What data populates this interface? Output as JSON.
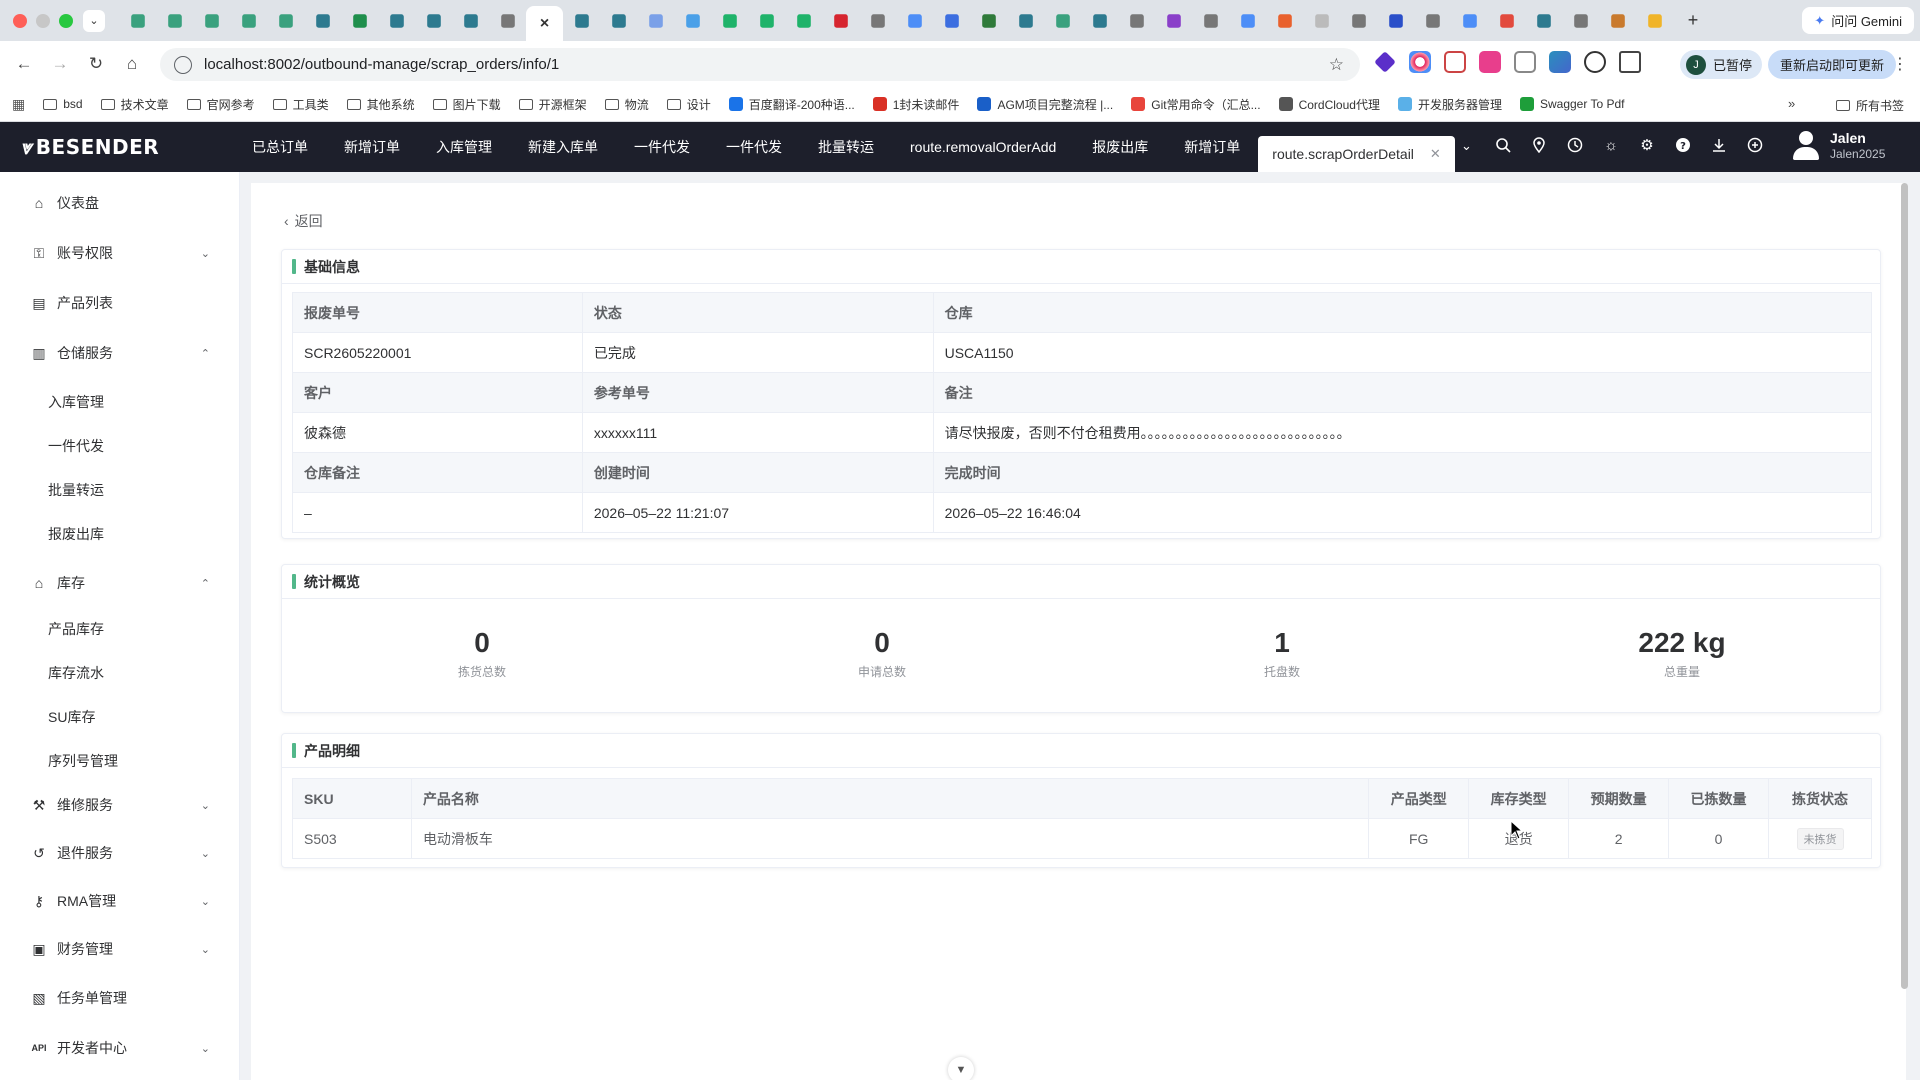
{
  "browser": {
    "url": "localhost:8002/outbound-manage/scrap_orders/info/1",
    "gemini_label": "问问 Gemini",
    "paused_label": "已暂停",
    "paused_avatar": "J",
    "relaunch_label": "重新启动即可更新",
    "bookmarks": [
      "bsd",
      "技术文章",
      "官网参考",
      "工具类",
      "其他系统",
      "图片下载",
      "开源框架",
      "物流",
      "设计",
      "百度翻译-200种语...",
      "1封未读邮件",
      "AGM项目完整流程 |...",
      "Git常用命令（汇总...",
      "CordCloud代理",
      "开发服务器管理",
      "Swagger To Pdf"
    ],
    "all_bookmarks": "所有书签"
  },
  "app": {
    "logo": "BESENDER",
    "nav_tabs": [
      "已总订单",
      "新增订单",
      "入库管理",
      "新建入库单",
      "一件代发",
      "一件代发",
      "批量转运",
      "route.removalOrderAdd",
      "报废出库",
      "新增订单",
      "route.scrapOrderDetail"
    ],
    "user_name": "Jalen",
    "user_sub": "Jalen2025"
  },
  "sidebar": {
    "items": [
      {
        "label": "仪表盘",
        "icon": "home-icon"
      },
      {
        "label": "账号权限",
        "icon": "key-icon"
      },
      {
        "label": "产品列表",
        "icon": "list-icon"
      },
      {
        "label": "仓储服务",
        "icon": "warehouse-icon"
      },
      {
        "label": "入库管理"
      },
      {
        "label": "一件代发"
      },
      {
        "label": "批量转运"
      },
      {
        "label": "报废出库"
      },
      {
        "label": "库存",
        "icon": "store-icon"
      },
      {
        "label": "产品库存"
      },
      {
        "label": "库存流水"
      },
      {
        "label": "SU库存"
      },
      {
        "label": "序列号管理"
      },
      {
        "label": "维修服务",
        "icon": "wrench-icon"
      },
      {
        "label": "退件服务",
        "icon": "return-icon"
      },
      {
        "label": "RMA管理",
        "icon": "lock-icon"
      },
      {
        "label": "财务管理",
        "icon": "finance-icon"
      },
      {
        "label": "任务单管理",
        "icon": "task-icon"
      },
      {
        "label": "开发者中心",
        "icon": "api-icon"
      }
    ],
    "api_badge": "API"
  },
  "page": {
    "back_label": "返回",
    "basic": {
      "title": "基础信息",
      "labels": [
        "报废单号",
        "状态",
        "仓库",
        "客户",
        "参考单号",
        "备注",
        "仓库备注",
        "创建时间",
        "完成时间"
      ],
      "values": [
        "SCR2605220001",
        "已完成",
        "USCA1150",
        "彼森德",
        "xxxxxx111",
        "请尽快报废，否则不付仓租费用。。。。。。。。。。。。。。。。。。。。。。。。。。。。。",
        "–",
        "2026–05–22 11:21:07",
        "2026–05–22 16:46:04"
      ]
    },
    "stats": {
      "title": "统计概览",
      "items": [
        {
          "value": "0",
          "label": "拣货总数"
        },
        {
          "value": "0",
          "label": "申请总数"
        },
        {
          "value": "1",
          "label": "托盘数"
        },
        {
          "value": "222 kg",
          "label": "总重量"
        }
      ]
    },
    "products": {
      "title": "产品明细",
      "headers": [
        "SKU",
        "产品名称",
        "产品类型",
        "库存类型",
        "预期数量",
        "已拣数量",
        "拣货状态"
      ],
      "rows": [
        {
          "sku": "S503",
          "name": "电动滑板车",
          "type": "FG",
          "stock_type": "退货",
          "expected": "2",
          "picked": "0",
          "status": "未拣货"
        }
      ]
    }
  }
}
